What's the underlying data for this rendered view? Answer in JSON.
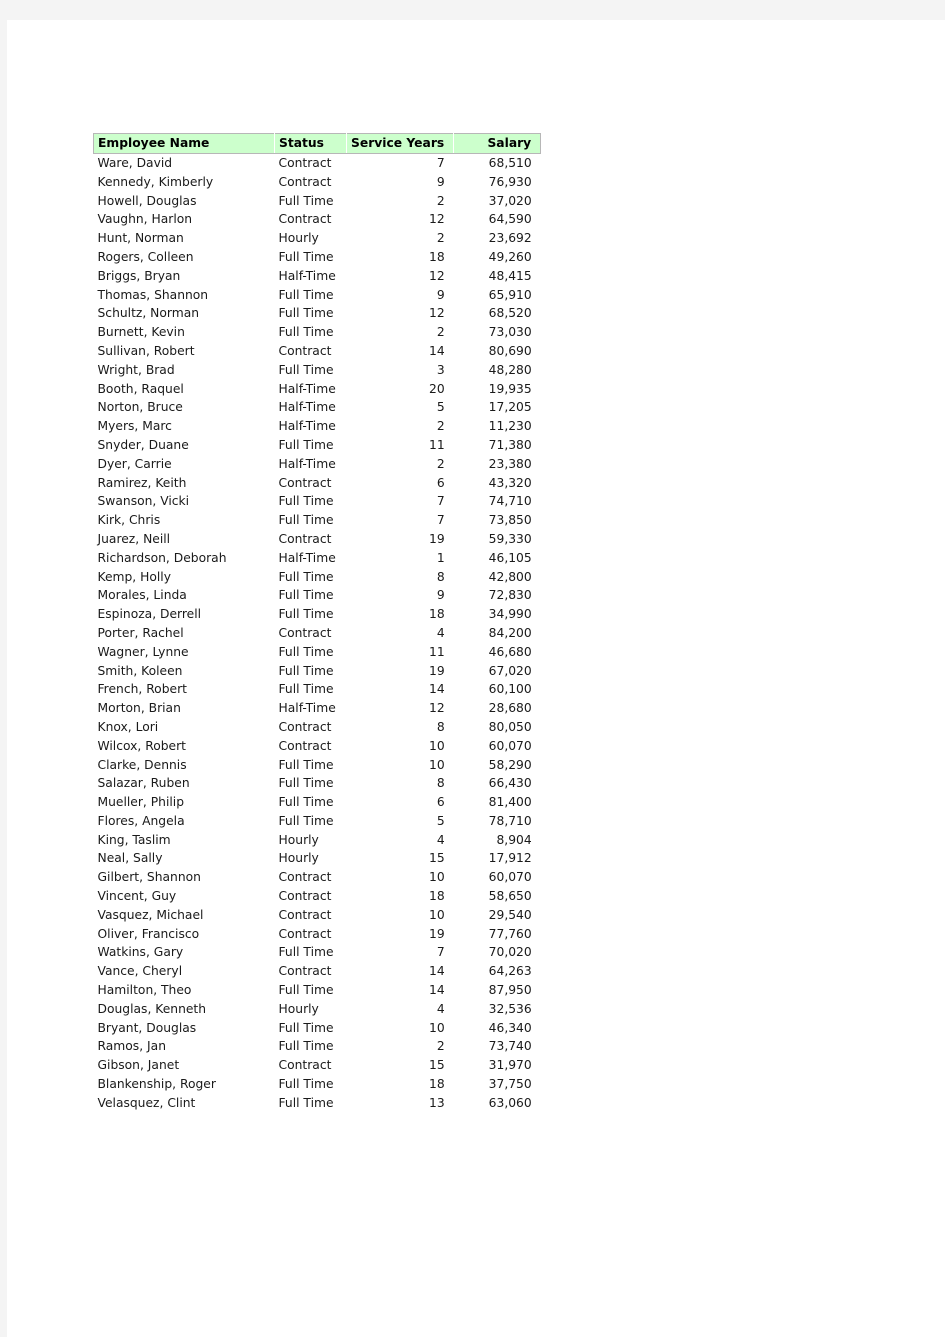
{
  "document": {
    "page_background": "#ffffff",
    "canvas_background": "#f4f4f4"
  },
  "table": {
    "header_background": "#ccffcc",
    "border_color": "#b7b7b7",
    "columns": [
      {
        "key": "name",
        "label": "Employee  Name",
        "align": "left"
      },
      {
        "key": "status",
        "label": "Status",
        "align": "left"
      },
      {
        "key": "years",
        "label": "Service  Years",
        "align": "right"
      },
      {
        "key": "salary",
        "label": "Salary",
        "align": "right"
      }
    ],
    "row_count": 51,
    "rows": [
      {
        "name": "Ware,  David",
        "status": "Contract",
        "years": "7",
        "salary": "68,510"
      },
      {
        "name": "Kennedy,  Kimberly",
        "status": "Contract",
        "years": "9",
        "salary": "76,930"
      },
      {
        "name": "Howell,  Douglas",
        "status": "Full  Time",
        "years": "2",
        "salary": "37,020"
      },
      {
        "name": "Vaughn,  Harlon",
        "status": "Contract",
        "years": "12",
        "salary": "64,590"
      },
      {
        "name": "Hunt,  Norman",
        "status": "Hourly",
        "years": "2",
        "salary": "23,692"
      },
      {
        "name": "Rogers,  Colleen",
        "status": "Full  Time",
        "years": "18",
        "salary": "49,260"
      },
      {
        "name": "Briggs,  Bryan",
        "status": "Half-Time",
        "years": "12",
        "salary": "48,415"
      },
      {
        "name": "Thomas,  Shannon",
        "status": "Full  Time",
        "years": "9",
        "salary": "65,910"
      },
      {
        "name": "Schultz,  Norman",
        "status": "Full  Time",
        "years": "12",
        "salary": "68,520"
      },
      {
        "name": "Burnett,  Kevin",
        "status": "Full  Time",
        "years": "2",
        "salary": "73,030"
      },
      {
        "name": "Sullivan,  Robert",
        "status": "Contract",
        "years": "14",
        "salary": "80,690"
      },
      {
        "name": "Wright,  Brad",
        "status": "Full  Time",
        "years": "3",
        "salary": "48,280"
      },
      {
        "name": "Booth,  Raquel",
        "status": "Half-Time",
        "years": "20",
        "salary": "19,935"
      },
      {
        "name": "Norton,  Bruce",
        "status": "Half-Time",
        "years": "5",
        "salary": "17,205"
      },
      {
        "name": "Myers,  Marc",
        "status": "Half-Time",
        "years": "2",
        "salary": "11,230"
      },
      {
        "name": "Snyder,  Duane",
        "status": "Full  Time",
        "years": "11",
        "salary": "71,380"
      },
      {
        "name": "Dyer,  Carrie",
        "status": "Half-Time",
        "years": "2",
        "salary": "23,380"
      },
      {
        "name": "Ramirez,  Keith",
        "status": "Contract",
        "years": "6",
        "salary": "43,320"
      },
      {
        "name": "Swanson,  Vicki",
        "status": "Full  Time",
        "years": "7",
        "salary": "74,710"
      },
      {
        "name": "Kirk,  Chris",
        "status": "Full  Time",
        "years": "7",
        "salary": "73,850"
      },
      {
        "name": "Juarez,  Neill",
        "status": "Contract",
        "years": "19",
        "salary": "59,330"
      },
      {
        "name": "Richardson,  Deborah",
        "status": "Half-Time",
        "years": "1",
        "salary": "46,105"
      },
      {
        "name": "Kemp,  Holly",
        "status": "Full  Time",
        "years": "8",
        "salary": "42,800"
      },
      {
        "name": "Morales,  Linda",
        "status": "Full  Time",
        "years": "9",
        "salary": "72,830"
      },
      {
        "name": "Espinoza,  Derrell",
        "status": "Full  Time",
        "years": "18",
        "salary": "34,990"
      },
      {
        "name": "Porter,  Rachel",
        "status": "Contract",
        "years": "4",
        "salary": "84,200"
      },
      {
        "name": "Wagner,  Lynne",
        "status": "Full  Time",
        "years": "11",
        "salary": "46,680"
      },
      {
        "name": "Smith,  Koleen",
        "status": "Full  Time",
        "years": "19",
        "salary": "67,020"
      },
      {
        "name": "French,  Robert",
        "status": "Full  Time",
        "years": "14",
        "salary": "60,100"
      },
      {
        "name": "Morton,  Brian",
        "status": "Half-Time",
        "years": "12",
        "salary": "28,680"
      },
      {
        "name": "Knox,  Lori",
        "status": "Contract",
        "years": "8",
        "salary": "80,050"
      },
      {
        "name": "Wilcox,  Robert",
        "status": "Contract",
        "years": "10",
        "salary": "60,070"
      },
      {
        "name": "Clarke,  Dennis",
        "status": "Full  Time",
        "years": "10",
        "salary": "58,290"
      },
      {
        "name": "Salazar,  Ruben",
        "status": "Full  Time",
        "years": "8",
        "salary": "66,430"
      },
      {
        "name": "Mueller,  Philip",
        "status": "Full  Time",
        "years": "6",
        "salary": "81,400"
      },
      {
        "name": "Flores,  Angela",
        "status": "Full  Time",
        "years": "5",
        "salary": "78,710"
      },
      {
        "name": "King,  Taslim",
        "status": "Hourly",
        "years": "4",
        "salary": "8,904"
      },
      {
        "name": "Neal,  Sally",
        "status": "Hourly",
        "years": "15",
        "salary": "17,912"
      },
      {
        "name": "Gilbert,  Shannon",
        "status": "Contract",
        "years": "10",
        "salary": "60,070"
      },
      {
        "name": "Vincent,  Guy",
        "status": "Contract",
        "years": "18",
        "salary": "58,650"
      },
      {
        "name": "Vasquez,  Michael",
        "status": "Contract",
        "years": "10",
        "salary": "29,540"
      },
      {
        "name": "Oliver,  Francisco",
        "status": "Contract",
        "years": "19",
        "salary": "77,760"
      },
      {
        "name": "Watkins,  Gary",
        "status": "Full  Time",
        "years": "7",
        "salary": "70,020"
      },
      {
        "name": "Vance,  Cheryl",
        "status": "Contract",
        "years": "14",
        "salary": "64,263"
      },
      {
        "name": "Hamilton,  Theo",
        "status": "Full  Time",
        "years": "14",
        "salary": "87,950"
      },
      {
        "name": "Douglas,  Kenneth",
        "status": "Hourly",
        "years": "4",
        "salary": "32,536"
      },
      {
        "name": "Bryant,  Douglas",
        "status": "Full  Time",
        "years": "10",
        "salary": "46,340"
      },
      {
        "name": "Ramos,  Jan",
        "status": "Full  Time",
        "years": "2",
        "salary": "73,740"
      },
      {
        "name": "Gibson,  Janet",
        "status": "Contract",
        "years": "15",
        "salary": "31,970"
      },
      {
        "name": "Blankenship,  Roger",
        "status": "Full  Time",
        "years": "18",
        "salary": "37,750"
      },
      {
        "name": "Velasquez,  Clint",
        "status": "Full  Time",
        "years": "13",
        "salary": "63,060"
      }
    ]
  }
}
